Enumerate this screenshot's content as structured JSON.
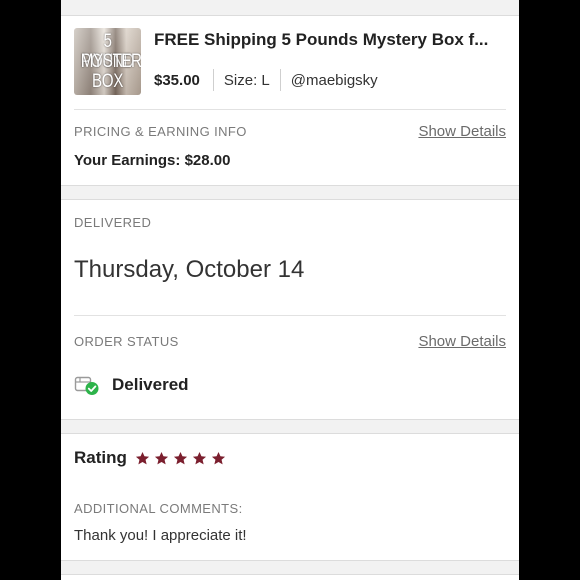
{
  "product": {
    "thumbnail_lines": [
      "5 POUND",
      "MYSTERY",
      "BOX"
    ],
    "title": "FREE Shipping 5 Pounds Mystery Box f...",
    "price": "$35.00",
    "size": "Size: L",
    "seller": "@maebigsky"
  },
  "pricing": {
    "label": "PRICING & EARNING INFO",
    "show_details": "Show Details",
    "earnings": "Your Earnings: $28.00"
  },
  "delivery": {
    "label": "DELIVERED",
    "date": "Thursday, October 14"
  },
  "order_status": {
    "label": "ORDER STATUS",
    "show_details": "Show Details",
    "status": "Delivered",
    "icon": "package-delivered-icon"
  },
  "rating": {
    "label": "Rating",
    "stars": 5,
    "max_stars": 5,
    "star_color": "#7b1f2e",
    "comments_label": "ADDITIONAL COMMENTS:",
    "comment": "Thank you! I appreciate it!"
  },
  "colors": {
    "status_green": "#2db34a"
  }
}
